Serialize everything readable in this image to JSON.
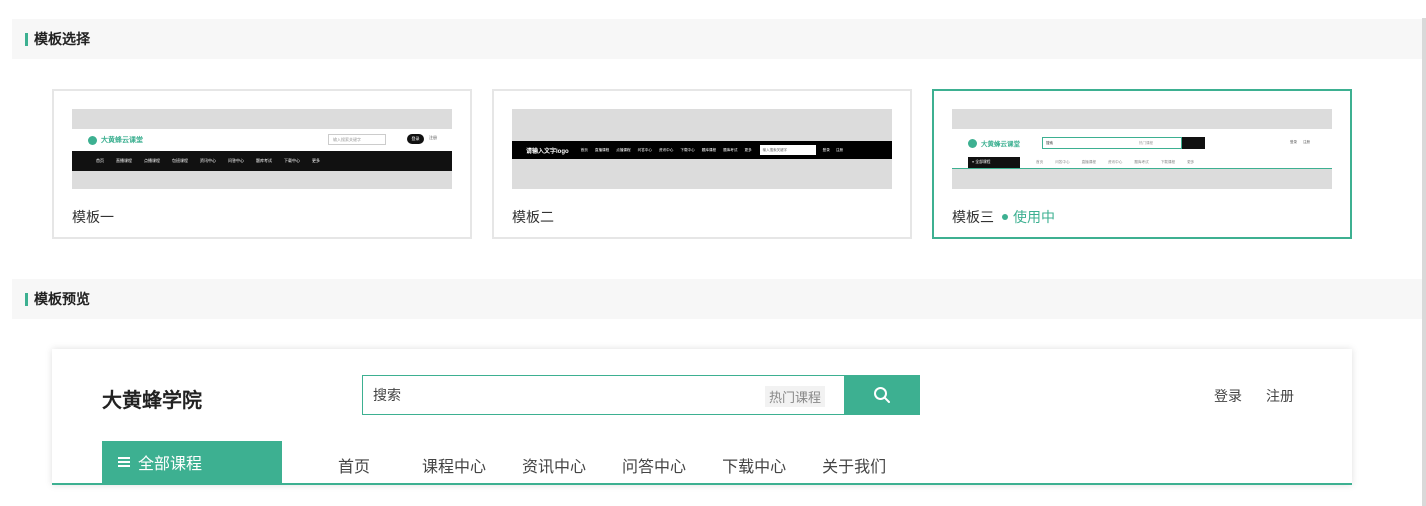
{
  "sections": {
    "template_select": "模板选择",
    "template_preview": "模板预览"
  },
  "templates": [
    {
      "name": "模板一",
      "thumb": {
        "logo": "大黄蜂云课堂",
        "search_placeholder": "输入搜索关键字",
        "login": "登录",
        "register": "注册",
        "nav": [
          "首页",
          "直播课程",
          "点播课程",
          "包班课程",
          "资讯中心",
          "问答中心",
          "题库考试",
          "下载中心",
          "更多"
        ]
      }
    },
    {
      "name": "模板二",
      "thumb": {
        "logo": "请输入文字logo",
        "nav": [
          "首页",
          "直播课程",
          "点播课程",
          "问答中心",
          "资讯中心",
          "下载中心",
          "题库课程",
          "题库考试",
          "更多"
        ],
        "search_placeholder": "输入搜索关键字",
        "login": "登录",
        "register": "注册"
      }
    },
    {
      "name": "模板三",
      "status": "使用中",
      "thumb": {
        "logo": "大黄蜂云课堂",
        "search_placeholder": "搜索",
        "hot": "热门课程",
        "login": "登录",
        "register": "注册",
        "all_courses": "全部课程",
        "nav": [
          "首页",
          "问答中心",
          "直播课程",
          "资讯中心",
          "题库考试",
          "下载课程",
          "更多"
        ]
      }
    }
  ],
  "preview": {
    "logo": "大黄蜂学院",
    "search_placeholder": "搜索",
    "hot_tag": "热门课程",
    "login": "登录",
    "register": "注册",
    "all_courses": "全部课程",
    "nav": [
      "首页",
      "课程中心",
      "资讯中心",
      "问答中心",
      "下载中心",
      "关于我们"
    ]
  },
  "colors": {
    "accent": "#3db091",
    "dark": "#111111"
  }
}
